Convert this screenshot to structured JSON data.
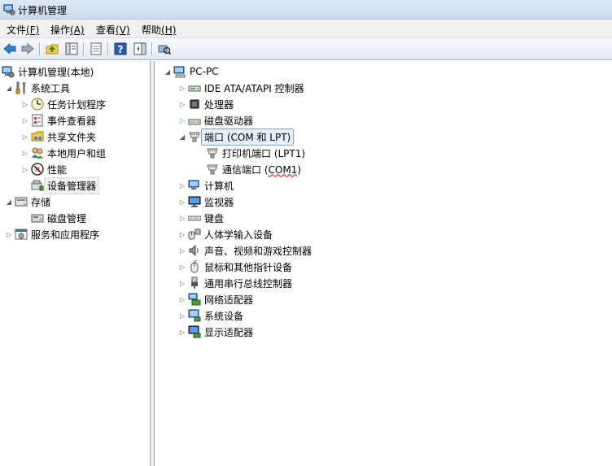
{
  "window": {
    "title": "计算机管理"
  },
  "menu": [
    {
      "label": "文件",
      "key": "(F)"
    },
    {
      "label": "操作",
      "key": "(A)"
    },
    {
      "label": "查看",
      "key": "(V)"
    },
    {
      "label": "帮助",
      "key": "(H)"
    }
  ],
  "toolbar": {
    "buttons": [
      "back-icon",
      "forward-icon",
      "up-folder-icon",
      "show-hide-tree-icon",
      "properties-icon",
      "help-icon",
      "action-pane-icon",
      "scan-hardware-icon"
    ]
  },
  "left_tree": {
    "root": "计算机管理(本地)",
    "system_tools": "系统工具",
    "task_scheduler": "任务计划程序",
    "event_viewer": "事件查看器",
    "shared_folders": "共享文件夹",
    "local_users": "本地用户和组",
    "performance": "性能",
    "device_manager": "设备管理器",
    "storage": "存储",
    "disk_management": "磁盘管理",
    "services_apps": "服务和应用程序"
  },
  "device_tree": {
    "root": "PC-PC",
    "ide": "IDE ATA/ATAPI 控制器",
    "processor": "处理器",
    "disk_drives": "磁盘驱动器",
    "ports": "端口 (COM 和 LPT)",
    "lpt1": "打印机端口 (LPT1)",
    "com1_prefix": "通信端口 (",
    "com1_name": "COM1",
    "com1_suffix": ")",
    "computer": "计算机",
    "monitors": "监视器",
    "keyboards": "键盘",
    "hid": "人体学输入设备",
    "sound": "声音、视频和游戏控制器",
    "mice": "鼠标和其他指针设备",
    "usb": "通用串行总线控制器",
    "network": "网络适配器",
    "system_devices": "系统设备",
    "display": "显示适配器"
  },
  "colors": {
    "selection_border": "#7da2ce",
    "selection_fill": "#e8f1fb",
    "expand_arrow_blue": "#26a0da"
  }
}
